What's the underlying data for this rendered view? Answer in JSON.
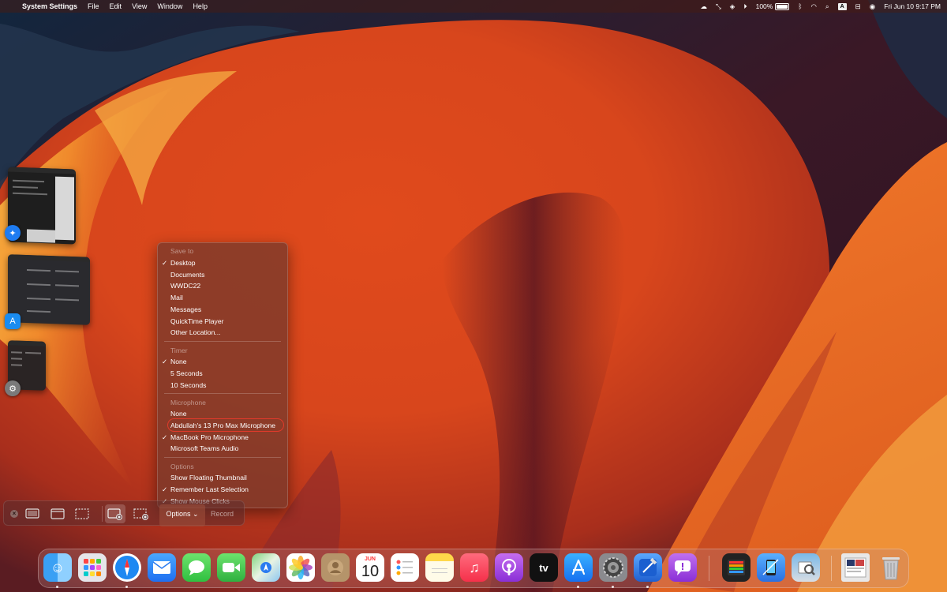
{
  "menubar": {
    "app_name": "System Settings",
    "menus": [
      "File",
      "Edit",
      "View",
      "Window",
      "Help"
    ],
    "battery": "100%",
    "input_source": "A",
    "datetime": "Fri Jun 10  9:17 PM"
  },
  "options_menu": {
    "save_to": {
      "heading": "Save to",
      "items": [
        {
          "label": "Desktop",
          "checked": true
        },
        {
          "label": "Documents",
          "checked": false
        },
        {
          "label": "WWDC22",
          "checked": false
        },
        {
          "label": "Mail",
          "checked": false
        },
        {
          "label": "Messages",
          "checked": false
        },
        {
          "label": "QuickTime Player",
          "checked": false
        },
        {
          "label": "Other Location...",
          "checked": false
        }
      ]
    },
    "timer": {
      "heading": "Timer",
      "items": [
        {
          "label": "None",
          "checked": true
        },
        {
          "label": "5 Seconds",
          "checked": false
        },
        {
          "label": "10 Seconds",
          "checked": false
        }
      ]
    },
    "microphone": {
      "heading": "Microphone",
      "items": [
        {
          "label": "None",
          "checked": false
        },
        {
          "label": "Abdullah's 13 Pro Max Microphone",
          "checked": false,
          "highlighted": true
        },
        {
          "label": "MacBook Pro Microphone",
          "checked": true
        },
        {
          "label": "Microsoft Teams Audio",
          "checked": false
        }
      ]
    },
    "options": {
      "heading": "Options",
      "items": [
        {
          "label": "Show Floating Thumbnail",
          "checked": false
        },
        {
          "label": "Remember Last Selection",
          "checked": true
        },
        {
          "label": "Show Mouse Clicks",
          "checked": true
        }
      ]
    },
    "check_glyph": "✓",
    "highlight_color": "#e03a2a"
  },
  "toolbar": {
    "options_label": "Options",
    "record_label": "Record"
  },
  "dock": {
    "calendar_month": "JUN",
    "calendar_day": "10",
    "tv_label": "tv",
    "apps": [
      "finder-icon",
      "launchpad-icon",
      "safari-icon",
      "mail-icon",
      "messages-icon",
      "facetime-icon",
      "maps-icon",
      "photos-icon",
      "contacts-icon",
      "calendar-icon",
      "reminders-icon",
      "notes-icon",
      "music-icon",
      "podcasts-icon",
      "tv-icon",
      "app-store-icon",
      "system-settings-icon",
      "xcode-icon",
      "feedback-assistant-icon",
      "final-cut-pro-icon",
      "simulator-icon",
      "preview-icon",
      "downloads-stack-icon",
      "trash-icon"
    ]
  }
}
